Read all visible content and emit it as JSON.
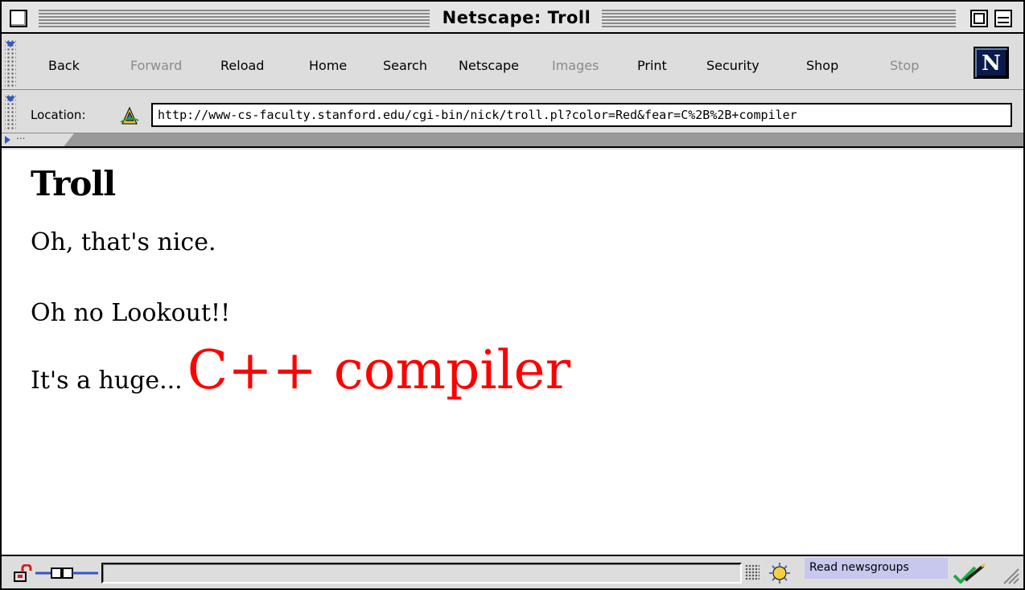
{
  "window": {
    "title": "Netscape: Troll"
  },
  "toolbar": {
    "buttons": [
      {
        "label": "Back",
        "enabled": true
      },
      {
        "label": "Forward",
        "enabled": false
      },
      {
        "label": "Reload",
        "enabled": true
      },
      {
        "label": "Home",
        "enabled": true
      },
      {
        "label": "Search",
        "enabled": true
      },
      {
        "label": "Netscape",
        "enabled": true
      },
      {
        "label": "Images",
        "enabled": false
      },
      {
        "label": "Print",
        "enabled": true
      },
      {
        "label": "Security",
        "enabled": true
      },
      {
        "label": "Shop",
        "enabled": true
      },
      {
        "label": "Stop",
        "enabled": false
      }
    ],
    "logo_letter": "N"
  },
  "location": {
    "label": "Location:",
    "url": "http://www-cs-faculty.stanford.edu/cgi-bin/nick/troll.pl?color=Red&fear=C%2B%2B+compiler"
  },
  "personal_toolbar": {
    "tab_label": "..."
  },
  "page": {
    "heading": "Troll",
    "paragraph1": "Oh, that's nice.",
    "paragraph2": "Oh no Lookout!!",
    "line3_prefix": "It's a huge...",
    "line3_highlight": "C++ compiler",
    "highlight_color": "#ff0000"
  },
  "statusbar": {
    "status_text": "",
    "tooltip": "Read newsgroups"
  },
  "icons": {
    "lock": "lock-icon",
    "connection": "connection-plug-icon",
    "newsgroups": "newsgroups-icon",
    "compose": "compose-icon",
    "location": "location-page-icon"
  }
}
